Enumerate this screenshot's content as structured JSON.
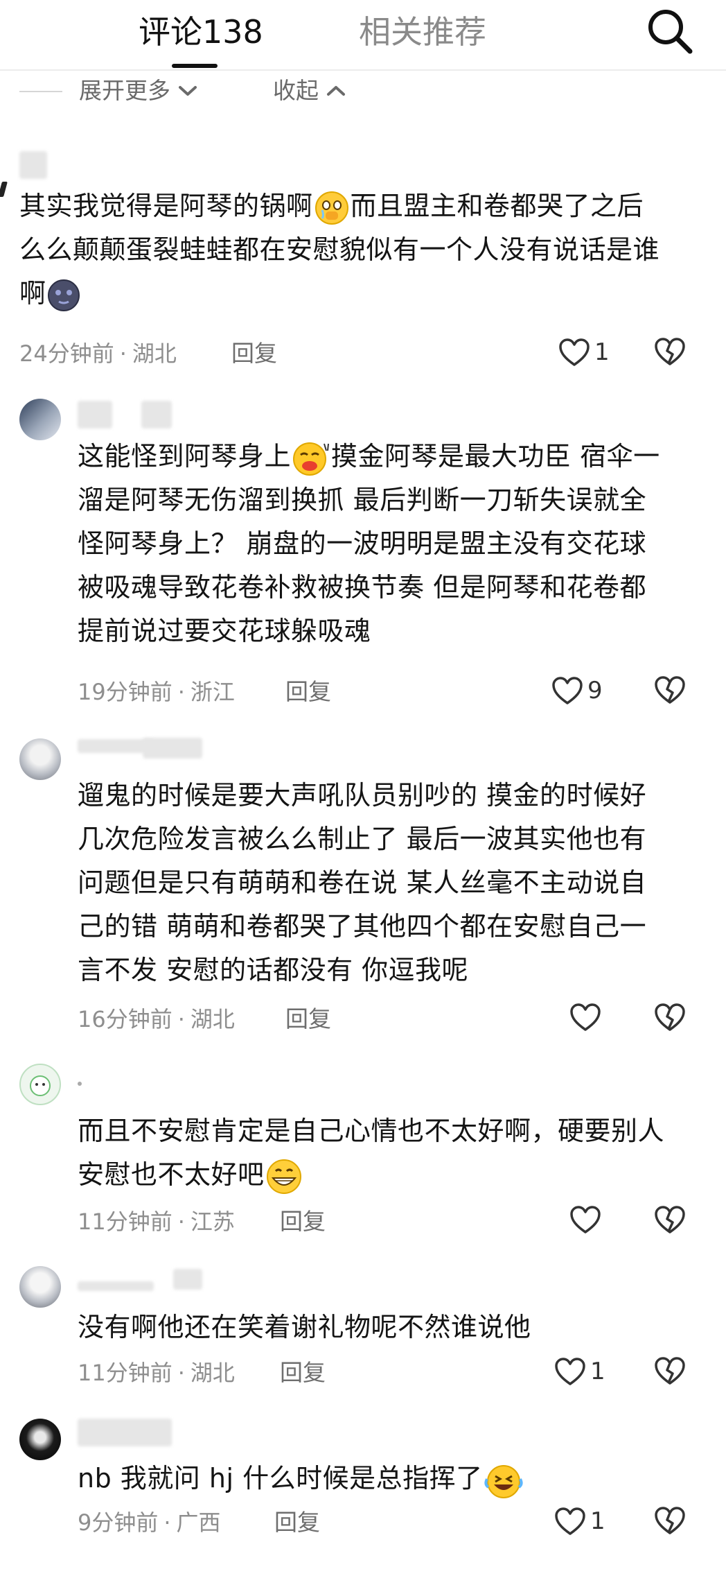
{
  "header": {
    "tab_comments": "评论138",
    "tab_related": "相关推荐"
  },
  "controls": {
    "expand_more": "展开更多",
    "collapse": "收起"
  },
  "comments": [
    {
      "lines": [
        "其实我觉得是阿琴的锅啊",
        "而且盟主和卷都哭了之后",
        "么么颠颠蛋裂蛙蛙都在安慰貌似有一个人没有说话是谁",
        "啊"
      ],
      "time": "24分钟前",
      "location": "湖北",
      "reply": "回复",
      "likes": "1"
    },
    {
      "lines": [
        "这能怪到阿琴身上",
        "摸金阿琴是最大功臣 宿伞一",
        "溜是阿琴无伤溜到换抓 最后判断一刀斩失误就全",
        "怪阿琴身上？ 崩盘的一波明明是盟主没有交花球",
        "被吸魂导致花卷补救被换节奏 但是阿琴和花卷都",
        "提前说过要交花球躲吸魂"
      ],
      "time": "19分钟前",
      "location": "浙江",
      "reply": "回复",
      "likes": "9"
    },
    {
      "lines": [
        "遛鬼的时候是要大声吼队员别吵的 摸金的时候好",
        "几次危险发言被么么制止了 最后一波其实他也有",
        "问题但是只有萌萌和卷在说 某人丝毫不主动说自",
        "己的错 萌萌和卷都哭了其他四个都在安慰自己一",
        "言不发 安慰的话都没有 你逗我呢"
      ],
      "time": "16分钟前",
      "location": "湖北",
      "reply": "回复",
      "likes": ""
    },
    {
      "lines": [
        "而且不安慰肯定是自己心情也不太好啊，硬要别人",
        "安慰也不太好吧"
      ],
      "time": "11分钟前",
      "location": "江苏",
      "reply": "回复",
      "likes": ""
    },
    {
      "lines": [
        "没有啊他还在笑着谢礼物呢不然谁说他"
      ],
      "time": "11分钟前",
      "location": "湖北",
      "reply": "回复",
      "likes": "1"
    },
    {
      "lines": [
        "nb 我就问 hj 什么时候是总指挥了"
      ],
      "time": "9分钟前",
      "location": "广西",
      "reply": "回复",
      "likes": "1"
    }
  ],
  "emoji_names": [
    "teary-eyes-emoji",
    "sly-face-emoji",
    "new-moon-face-emoji",
    "grin-emoji",
    "laugh-cry-emoji"
  ],
  "colors": {
    "text": "#141414",
    "meta": "#8e8e8e",
    "divider": "#ececec"
  }
}
